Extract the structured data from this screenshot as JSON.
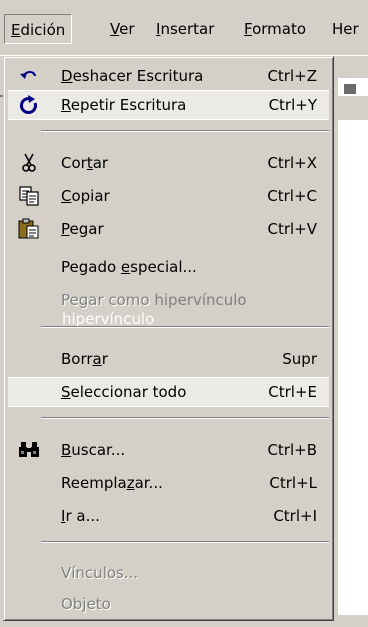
{
  "menubar": {
    "items": [
      {
        "label": "Edición",
        "underline": "E",
        "rest": "dición",
        "active": true
      },
      {
        "label": "Ver",
        "underline": "V",
        "rest": "er"
      },
      {
        "label": "Insertar",
        "underline": "I",
        "rest": "nsertar"
      },
      {
        "label": "Formato",
        "underline": "F",
        "rest": "ormato"
      },
      {
        "label": "Her",
        "underline": "",
        "rest": "Her"
      }
    ]
  },
  "menu": {
    "undo": {
      "pre": "",
      "u": "D",
      "post": "eshacer Escritura",
      "shortcut": "Ctrl+Z",
      "icon": "undo-icon"
    },
    "redo": {
      "pre": "",
      "u": "R",
      "post": "epetir Escritura",
      "shortcut": "Ctrl+Y",
      "icon": "redo-icon"
    },
    "cut": {
      "pre": "Cor",
      "u": "t",
      "post": "ar",
      "shortcut": "Ctrl+X",
      "icon": "scissors-icon"
    },
    "copy": {
      "pre": "",
      "u": "C",
      "post": "opiar",
      "shortcut": "Ctrl+C",
      "icon": "copy-icon"
    },
    "paste": {
      "pre": "",
      "u": "P",
      "post": "egar",
      "shortcut": "Ctrl+V",
      "icon": "clipboard-icon"
    },
    "paste_special": {
      "pre": "Pegado ",
      "u": "e",
      "post": "special...",
      "shortcut": ""
    },
    "paste_hyperlink": {
      "label": "Pegar como hipervínculo"
    },
    "clear": {
      "pre": "Borr",
      "u": "a",
      "post": "r",
      "shortcut": "Supr"
    },
    "select_all": {
      "pre": "",
      "u": "S",
      "post": "eleccionar todo",
      "shortcut": "Ctrl+E"
    },
    "find": {
      "pre": "",
      "u": "B",
      "post": "uscar...",
      "shortcut": "Ctrl+B",
      "icon": "binoculars-icon"
    },
    "replace": {
      "pre": "Reempla",
      "u": "z",
      "post": "ar...",
      "shortcut": "Ctrl+L"
    },
    "goto": {
      "pre": "",
      "u": "I",
      "post": "r a...",
      "shortcut": "Ctrl+I"
    },
    "links": {
      "label": "Vínculos..."
    },
    "object": {
      "label": "Objeto"
    }
  }
}
